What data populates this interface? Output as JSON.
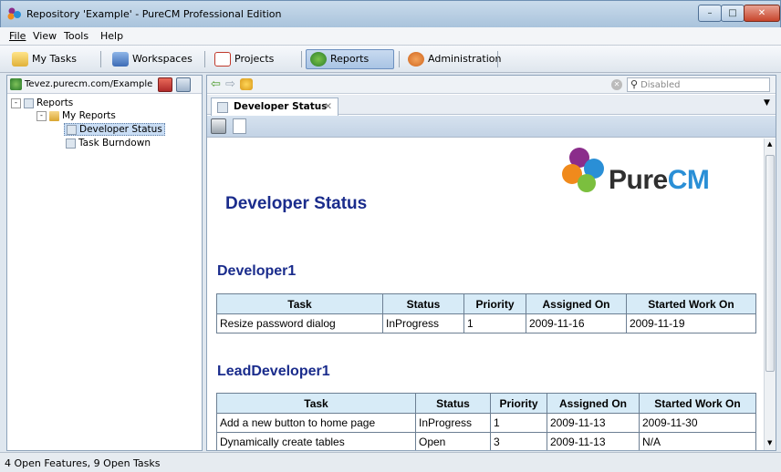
{
  "window": {
    "title": "Repository 'Example' - PureCM Professional Edition",
    "controls": [
      "–",
      "□",
      "✕"
    ]
  },
  "menu": [
    "File",
    "View",
    "Tools",
    "Help"
  ],
  "toolbar": {
    "my_tasks": "My Tasks",
    "workspaces": "Workspaces",
    "projects": "Projects",
    "reports": "Reports",
    "administration": "Administration"
  },
  "left": {
    "server": "Tevez.purecm.com/Example",
    "tree": {
      "root": "Reports",
      "folder": "My Reports",
      "items": [
        "Developer Status",
        "Task Burndown"
      ]
    }
  },
  "search": {
    "placeholder": "Disabled"
  },
  "tab": {
    "label": "Developer Status",
    "close": "✕"
  },
  "report": {
    "title": "Developer Status",
    "logo_text": {
      "pure": "Pure",
      "cm": "CM"
    },
    "headers": [
      "Task",
      "Status",
      "Priority",
      "Assigned On",
      "Started Work On"
    ],
    "sections": [
      {
        "developer": "Developer1",
        "rows": [
          [
            "Resize password dialog",
            "InProgress",
            "1",
            "2009-11-16",
            "2009-11-19"
          ]
        ]
      },
      {
        "developer": "LeadDeveloper1",
        "rows": [
          [
            "Add a new button to home page",
            "InProgress",
            "1",
            "2009-11-13",
            "2009-11-30"
          ],
          [
            "Dynamically create tables",
            "Open",
            "3",
            "2009-11-13",
            "N/A"
          ]
        ]
      }
    ]
  },
  "status": {
    "text": "4 Open Features, 9 Open Tasks"
  },
  "colors": {
    "heading": "#1a2c8c",
    "table_header": "#d7ebf7",
    "logo_cm": "#2a8fd6"
  }
}
